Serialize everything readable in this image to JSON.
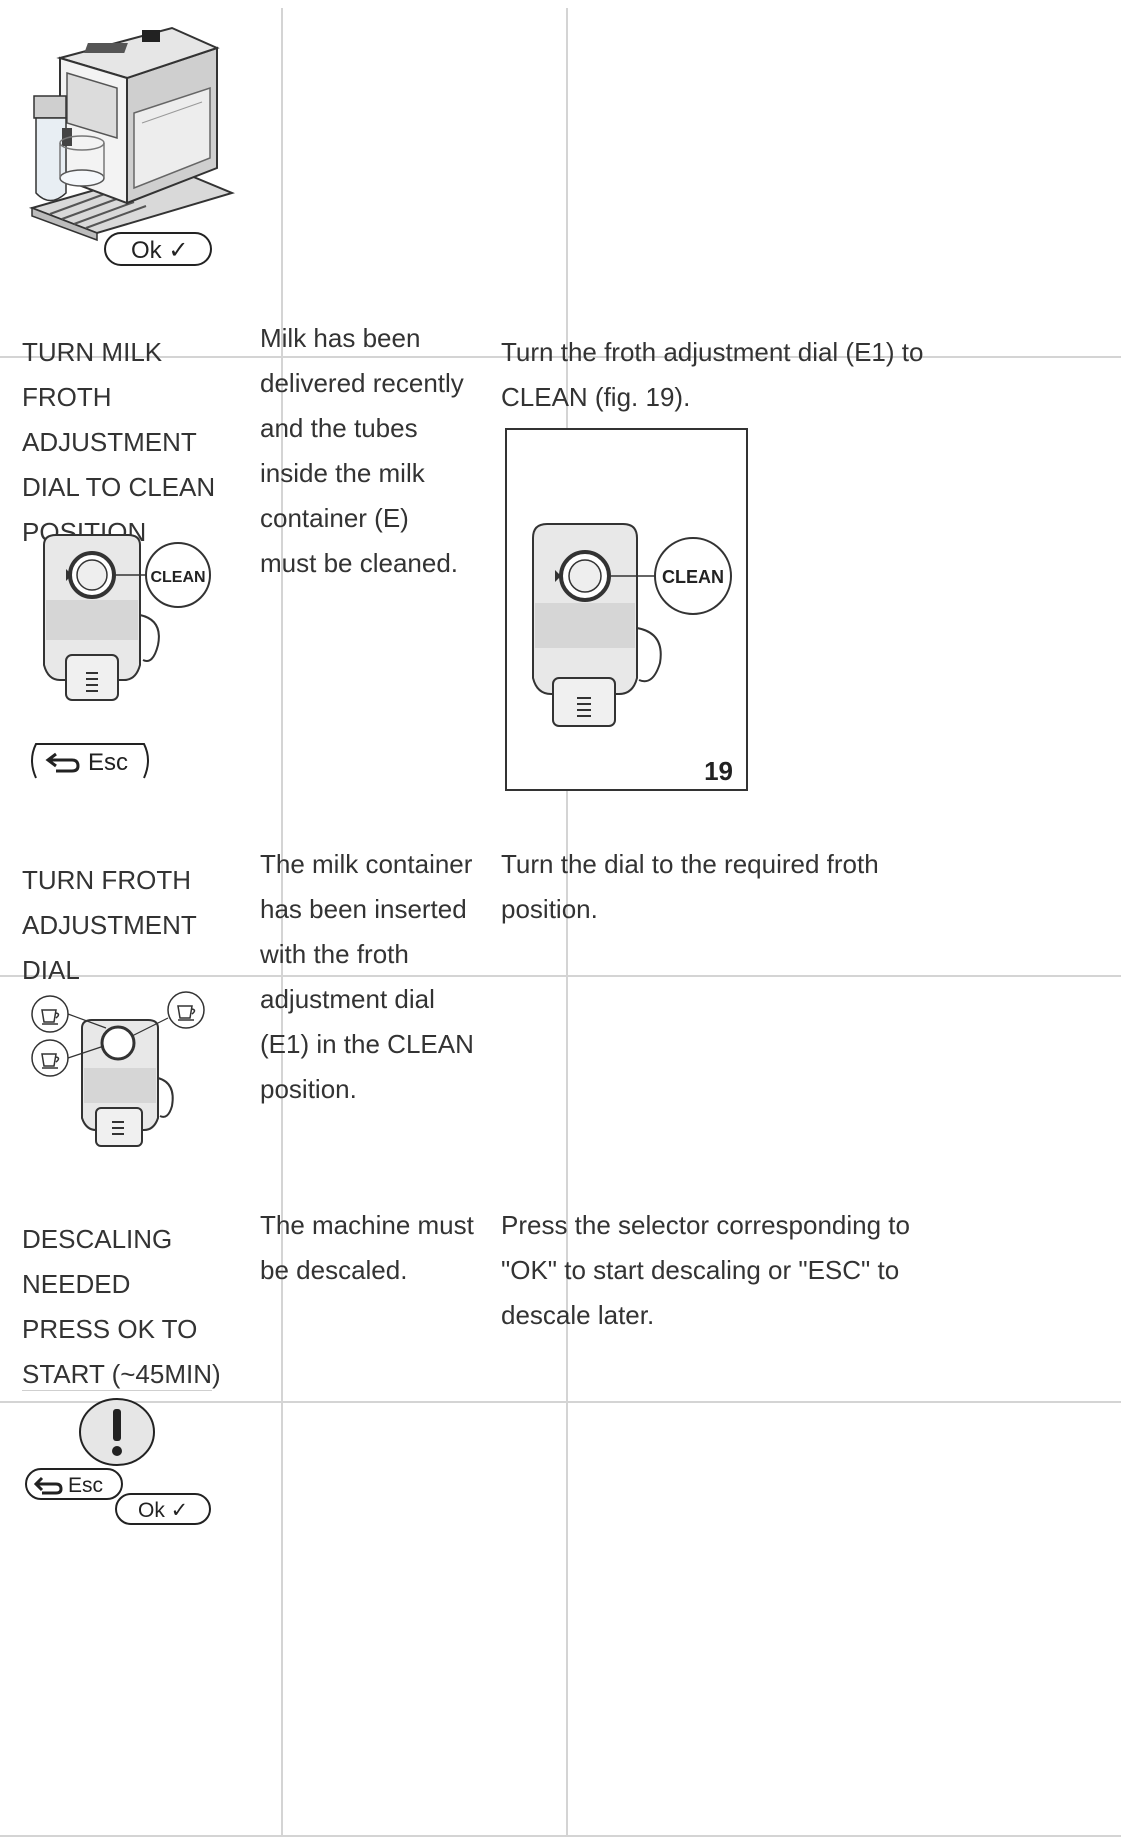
{
  "rows": [
    {
      "message": "",
      "cause": "",
      "solution": "",
      "display_buttons": [
        "Ok ✓"
      ]
    },
    {
      "message": "TURN MILK FROTH ADJUSTMENT DIAL TO CLEAN POSITION",
      "cause": "Milk has been delivered recently and the tubes inside the milk container (E) must be cleaned.",
      "solution": "Turn the froth adjustment dial (E1) to CLEAN (fig. 19).",
      "display_label": "CLEAN",
      "display_buttons": [
        "Esc"
      ],
      "figure_label": "CLEAN",
      "figure_number": "19"
    },
    {
      "message": "TURN FROTH ADJUSTMENT DIAL",
      "cause": "The milk container has been inserted with the froth adjustment dial (E1) in the CLEAN position.",
      "solution": "Turn the dial to the required froth position."
    },
    {
      "message": "DESCALING NEEDED PRESS OK TO START (~45MIN)",
      "cause": "The machine must be descaled.",
      "solution": "Press the selector corresponding to \"OK\" to start descaling or \"ESC\" to descale later.",
      "display_buttons": [
        "Esc",
        "Ok ✓"
      ]
    }
  ]
}
